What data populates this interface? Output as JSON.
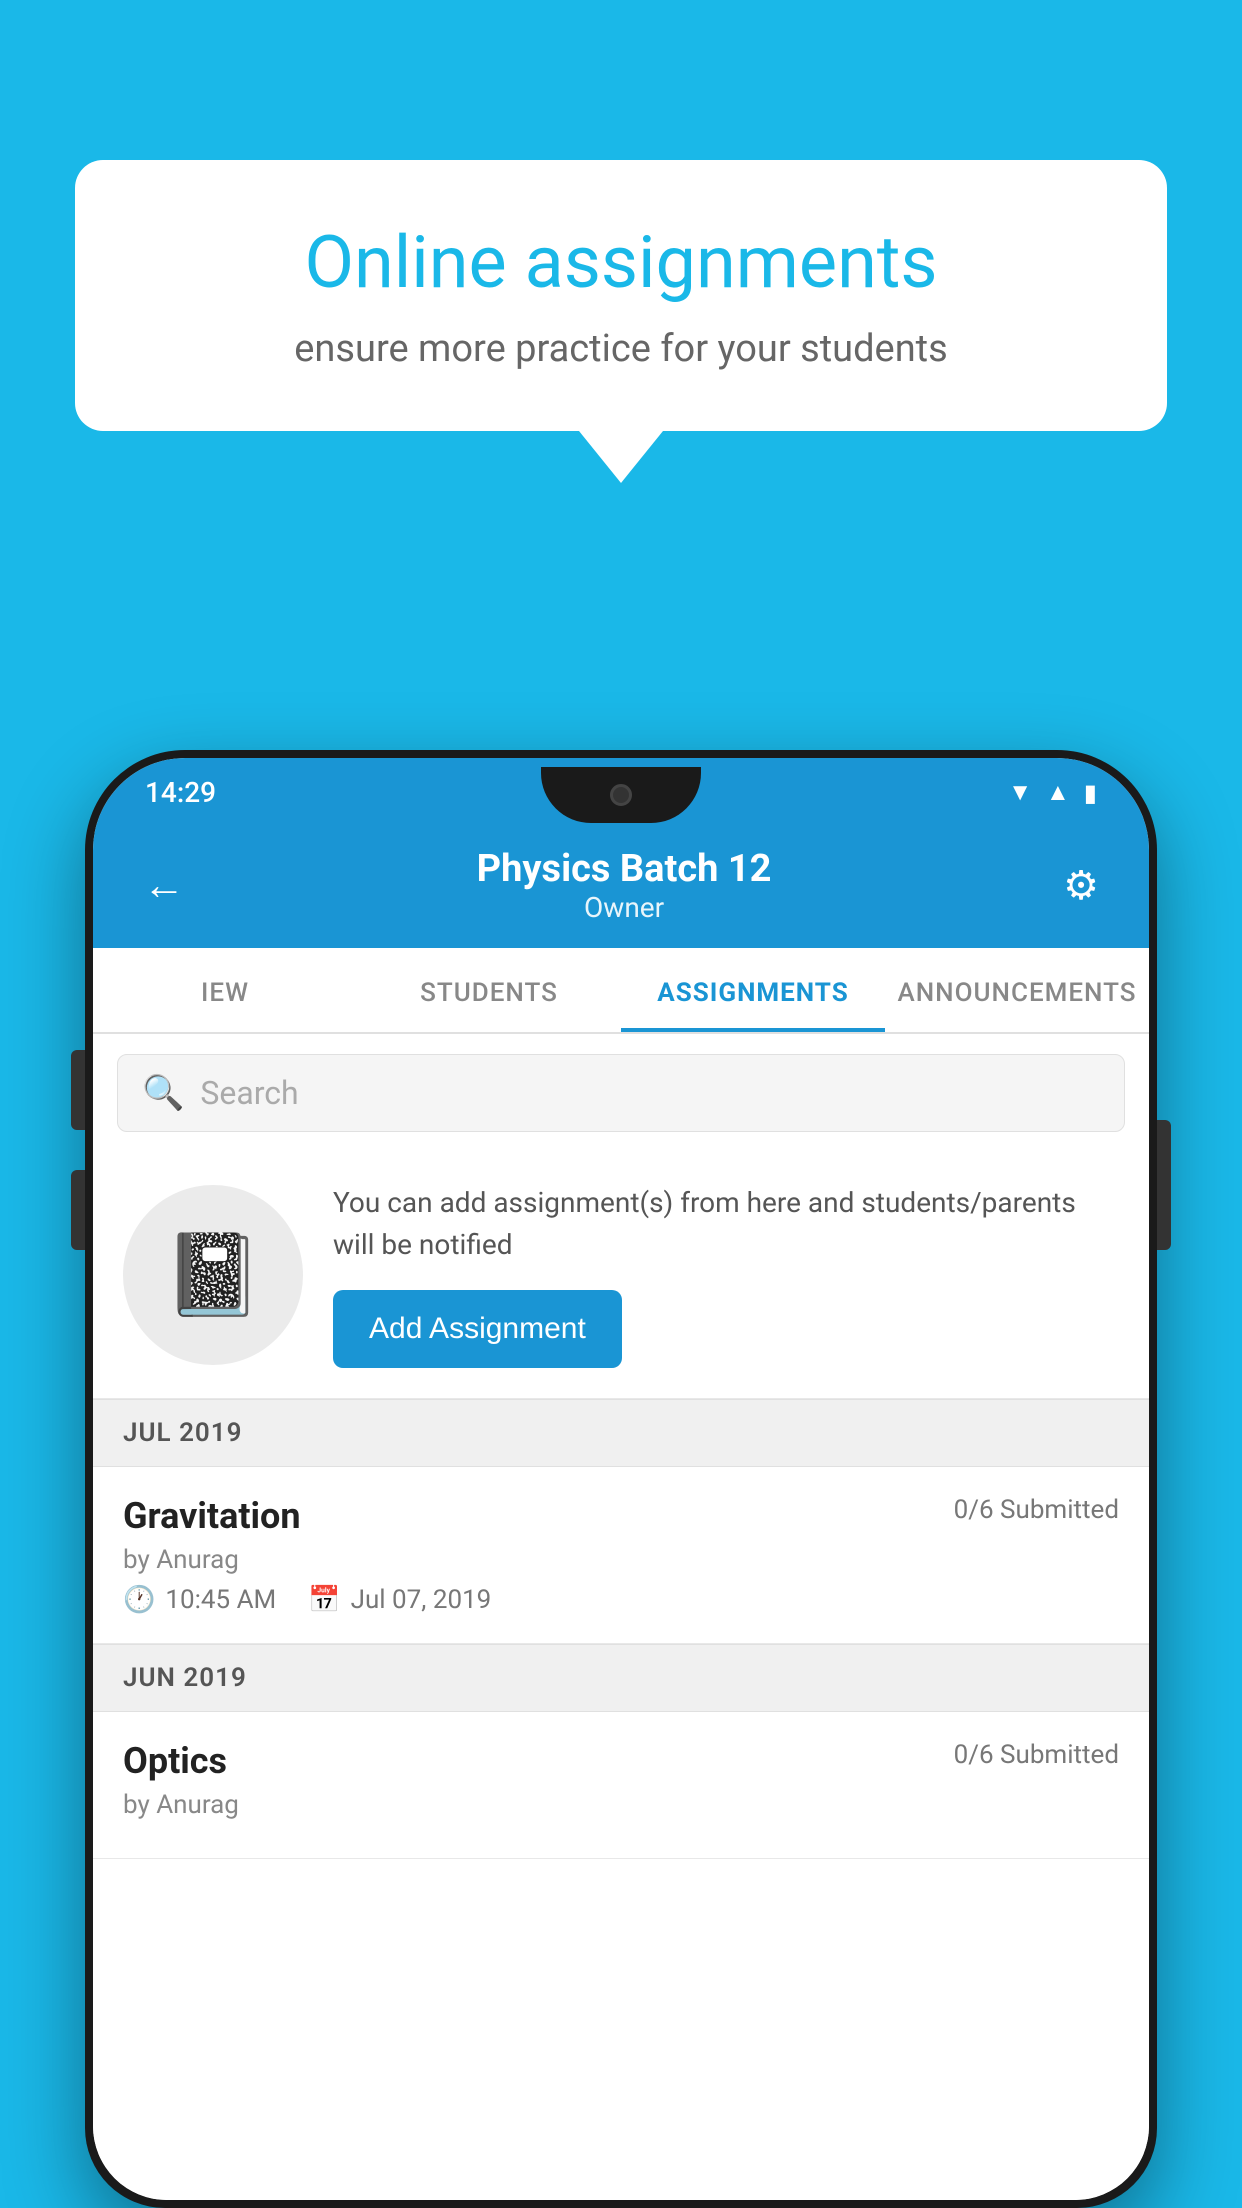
{
  "background_color": "#1ab8e8",
  "speech_bubble": {
    "title": "Online assignments",
    "subtitle": "ensure more practice for your students"
  },
  "status_bar": {
    "time": "14:29",
    "icons": [
      "wifi",
      "signal",
      "battery"
    ]
  },
  "app_bar": {
    "title": "Physics Batch 12",
    "subtitle": "Owner",
    "back_label": "←",
    "settings_label": "⚙"
  },
  "tabs": [
    {
      "label": "IEW",
      "active": false
    },
    {
      "label": "STUDENTS",
      "active": false
    },
    {
      "label": "ASSIGNMENTS",
      "active": true
    },
    {
      "label": "ANNOUNCEMENTS",
      "active": false
    }
  ],
  "search": {
    "placeholder": "Search"
  },
  "promo_card": {
    "description": "You can add assignment(s) from here and students/parents will be notified",
    "button_label": "Add Assignment"
  },
  "sections": [
    {
      "month": "JUL 2019",
      "assignments": [
        {
          "name": "Gravitation",
          "submitted": "0/6 Submitted",
          "author": "by Anurag",
          "time": "10:45 AM",
          "date": "Jul 07, 2019"
        }
      ]
    },
    {
      "month": "JUN 2019",
      "assignments": [
        {
          "name": "Optics",
          "submitted": "0/6 Submitted",
          "author": "by Anurag",
          "time": "",
          "date": ""
        }
      ]
    }
  ]
}
